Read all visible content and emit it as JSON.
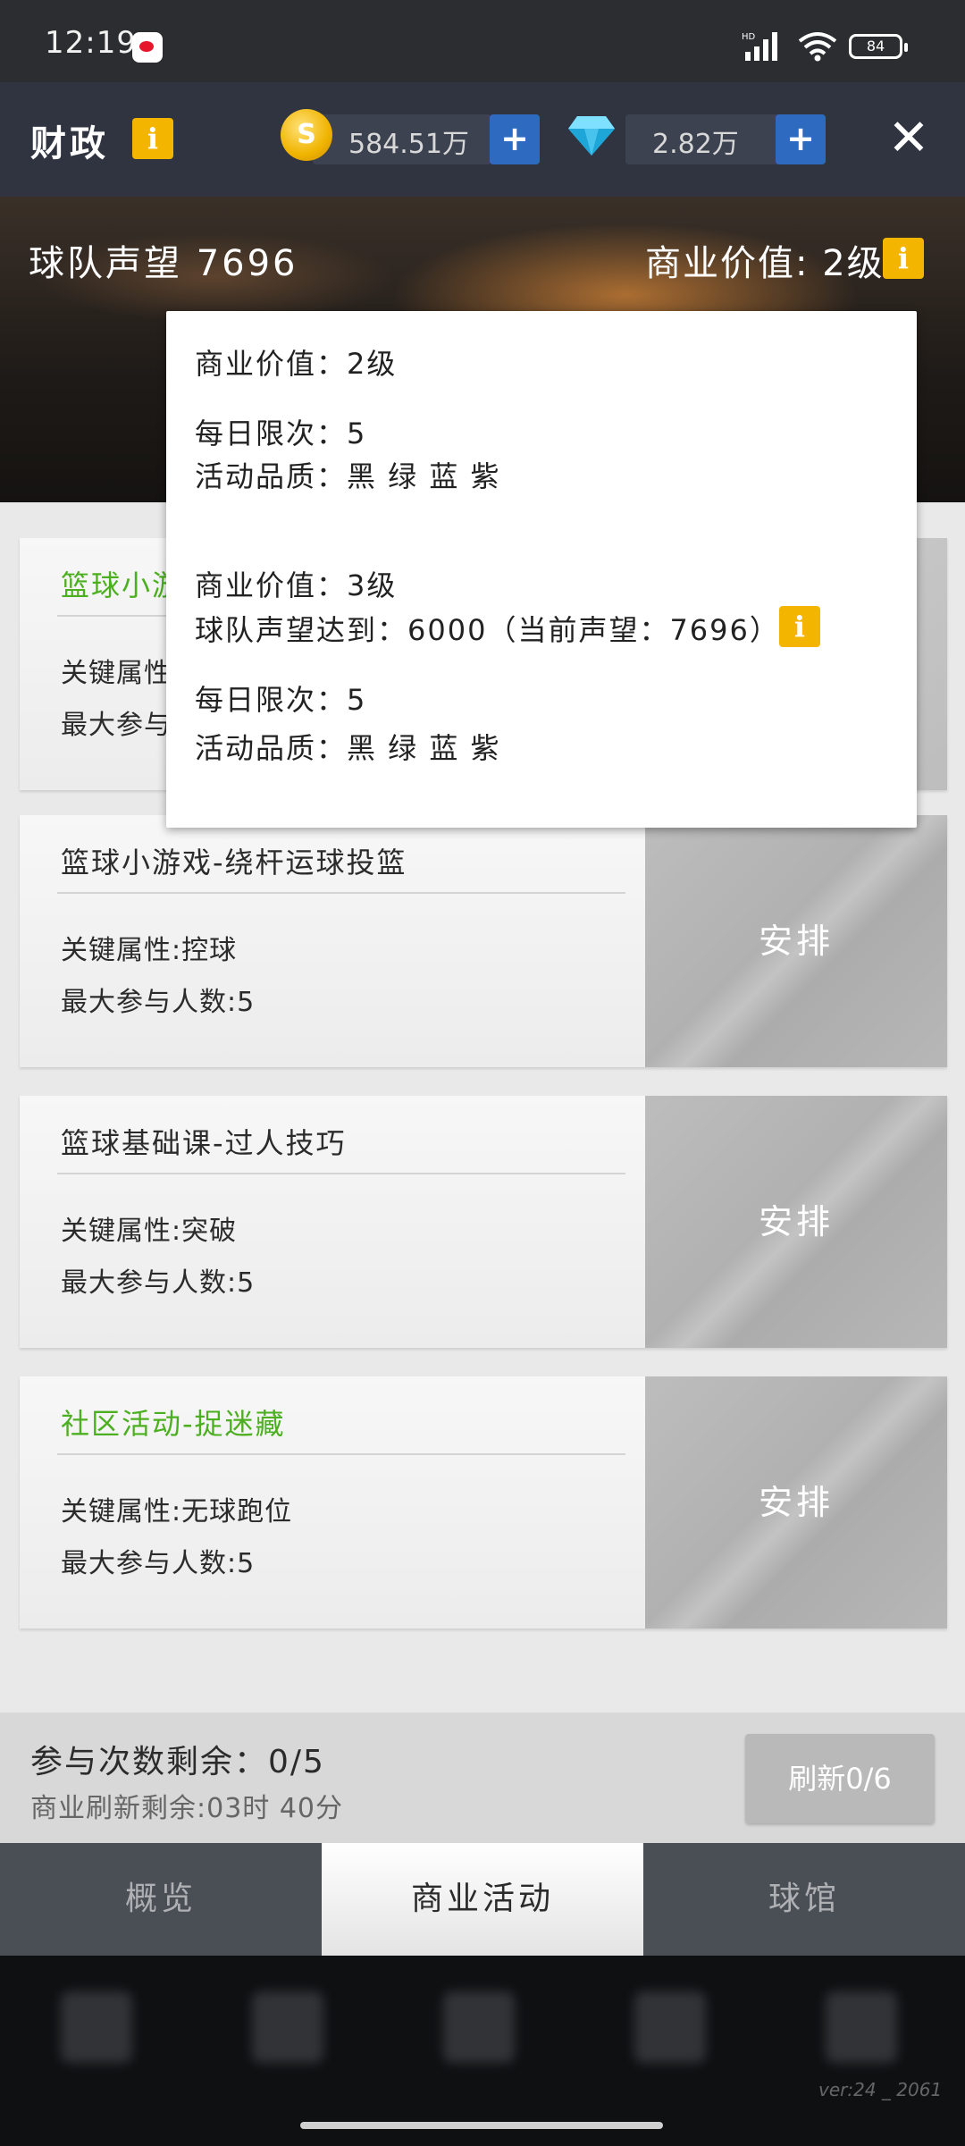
{
  "status_bar": {
    "time": "12:19",
    "battery": "84",
    "network": "HD"
  },
  "header": {
    "title": "财政",
    "coins": {
      "icon": "S",
      "value": "584.51万"
    },
    "gems": {
      "value": "2.82万"
    },
    "plus": "+",
    "close": "✕"
  },
  "banner": {
    "reputation": "球队声望 7696",
    "commercial_value": "商业价值: 2级",
    "info_icon": "i"
  },
  "popup": {
    "current_level": "商业价值：2级",
    "current_daily": "每日限次：5",
    "current_quality": "活动品质：黑 绿 蓝 紫",
    "next_level": "商业价值：3级",
    "next_requirement": "球队声望达到：6000（当前声望：7696）",
    "next_daily": "每日限次：5",
    "next_quality": "活动品质：黑 绿 蓝 紫"
  },
  "cards": [
    {
      "title": "篮球小游戏-绕杆运球投篮",
      "attr": "关键属性:控球",
      "max": "最大参与人数:5",
      "button": "安排",
      "color": "#2b2b2b"
    },
    {
      "title": "篮球基础课-过人技巧",
      "attr": "关键属性:突破",
      "max": "最大参与人数:5",
      "button": "安排",
      "color": "#2b2b2b"
    },
    {
      "title": "社区活动-捉迷藏",
      "attr": "关键属性:无球跑位",
      "max": "最大参与人数:5",
      "button": "安排",
      "color": "#4caf1f"
    }
  ],
  "card0_partial": {
    "title": "篮球小游",
    "attr": "关键属性",
    "max": "最大参与"
  },
  "footer": {
    "remaining": "参与次数剩余：0/5",
    "refresh_time": "商业刷新剩余:03时 40分",
    "refresh_button": "刷新0/6"
  },
  "tabs": [
    "概览",
    "商业活动",
    "球馆"
  ],
  "version": "ver:24 _ 2061"
}
